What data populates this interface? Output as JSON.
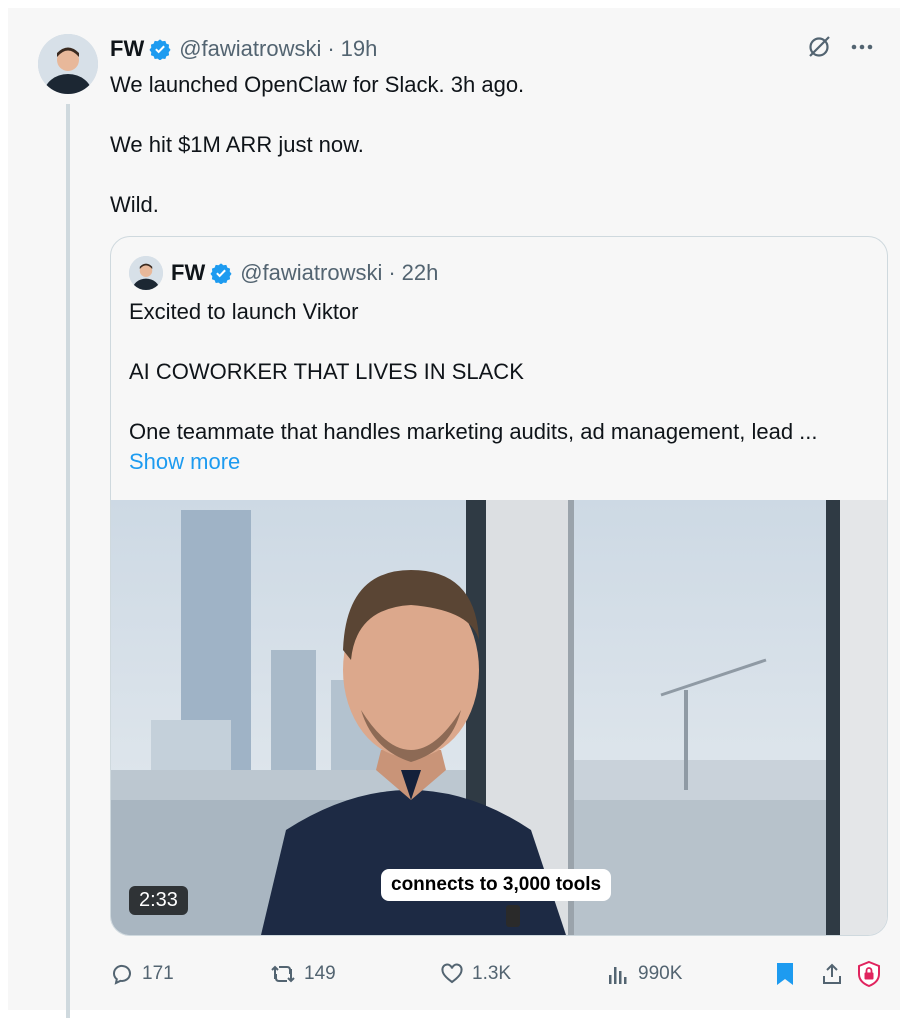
{
  "tweet": {
    "author": {
      "name": "FW",
      "handle": "@fawiatrowski",
      "time": "19h"
    },
    "lines": [
      "We launched OpenClaw for Slack. 3h ago.",
      "We hit $1M ARR just now.",
      "Wild."
    ],
    "top_icons": [
      "grok-icon",
      "more-icon"
    ]
  },
  "quote": {
    "author": {
      "name": "FW",
      "handle": "@fawiatrowski",
      "time": "22h"
    },
    "lines": [
      "Excited to launch Viktor",
      "AI COWORKER THAT LIVES IN SLACK",
      "One teammate that handles marketing audits, ad management, lead ..."
    ],
    "show_more": "Show more",
    "media": {
      "duration": "2:33",
      "caption": "connects to 3,000 tools"
    }
  },
  "actions": {
    "replies": "171",
    "reposts": "149",
    "likes": "1.3K",
    "views": "990K"
  },
  "colors": {
    "accent": "#1d9bf0",
    "muted": "#536471",
    "text": "#0f1419",
    "bookmark": "#1d9bf0",
    "shield": "#e0245e"
  }
}
